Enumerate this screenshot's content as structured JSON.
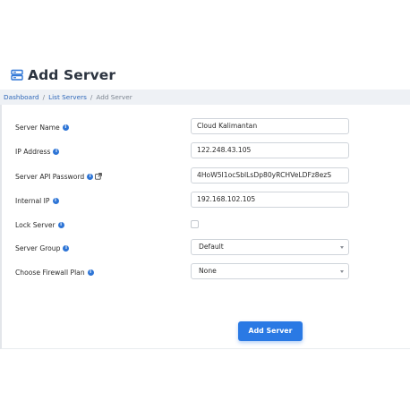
{
  "page": {
    "title": "Add Server"
  },
  "breadcrumb": {
    "items": [
      "Dashboard",
      "List Servers",
      "Add Server"
    ],
    "separator": "/"
  },
  "form": {
    "fields": [
      {
        "label": "Server Name",
        "value": "Cloud Kalimantan"
      },
      {
        "label": "IP Address",
        "value": "122.248.43.105"
      },
      {
        "label": "Server API Password",
        "value": "4HoW5I1ocSblLsDp80yRCHVeLDFz8ezS"
      },
      {
        "label": "Internal IP",
        "value": "192.168.102.105"
      },
      {
        "label": "Lock Server",
        "checked": false
      },
      {
        "label": "Server Group",
        "selected": "Default"
      },
      {
        "label": "Choose Firewall Plan",
        "selected": "None"
      }
    ],
    "submit_label": "Add Server"
  },
  "icons": {
    "title": "server-icon",
    "info": "info-icon",
    "external": "external-link-icon"
  },
  "colors": {
    "accent": "#2a79e4",
    "info": "#2e75d6",
    "link": "#2f68b9"
  }
}
